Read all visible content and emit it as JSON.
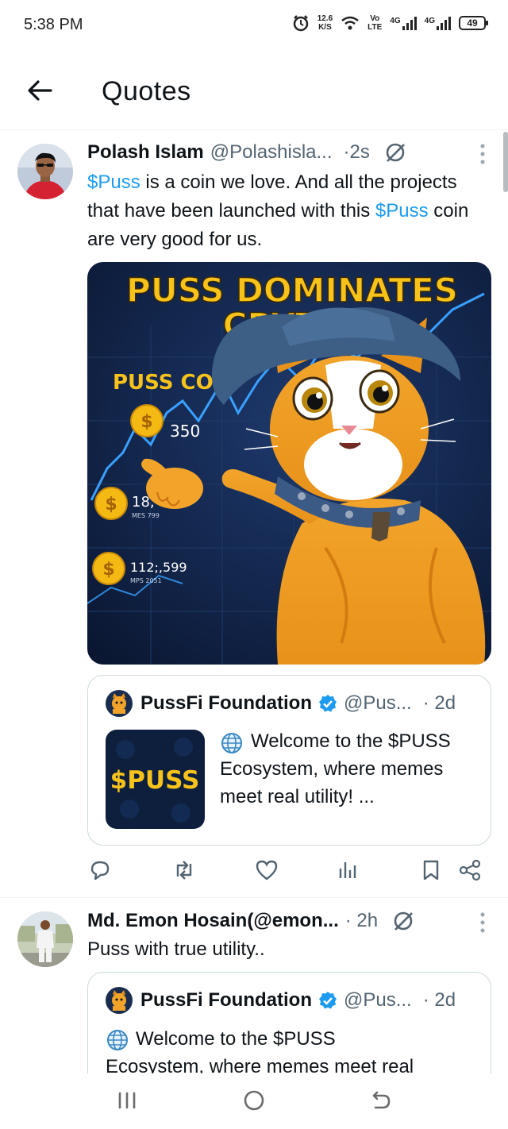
{
  "status_bar": {
    "time": "5:38 PM",
    "net_speed_value": "12.6",
    "net_speed_unit": "K/S",
    "volte_top": "Vo",
    "volte_bottom": "LTE",
    "sig1_label": "4G",
    "sig2_label": "4G",
    "battery": "49"
  },
  "header": {
    "title": "Quotes"
  },
  "tweets": [
    {
      "name": "Polash Islam",
      "handle": "@Polashisla...",
      "time": "·2s",
      "text_parts": [
        "$Puss",
        " is a coin we love. And all the projects that have been launched with this ",
        "$Puss",
        " coin are very good for us."
      ],
      "media": {
        "headline_1": "PUSS DOMINATES",
        "headline_2": "CRYTO!",
        "coin_label": "PUSS COIN",
        "coin_value_1": "350",
        "coin_value_2": "18,",
        "coin_sub_2": "MES 799",
        "coin_value_3": "112;,599",
        "coin_sub_3": "MPS 2051",
        "coin_symbol": "$"
      },
      "quote": {
        "name": "PussFi Foundation",
        "handle": "@Pus...",
        "time": "· 2d",
        "thumb_text": "$PUSS",
        "globe_icon": "globe-icon",
        "text": "Welcome to the $PUSS Ecosystem, where memes meet real utility! ..."
      }
    },
    {
      "name": "Md. Emon Hosain(@emon...",
      "time": "· 2h",
      "text": "Puss with true utility..",
      "quote": {
        "name": "PussFi Foundation",
        "handle": "@Pus...",
        "time": "· 2d",
        "text_line_1": "Welcome to the $PUSS",
        "text_line_2": "Ecosystem, where memes meet real"
      }
    }
  ],
  "colors": {
    "accent": "#1d9bf0",
    "text": "#0f1419",
    "muted": "#536471",
    "border": "#cfd9de",
    "media_bg": "#0e1f3f",
    "headline": "#f7c21a"
  }
}
